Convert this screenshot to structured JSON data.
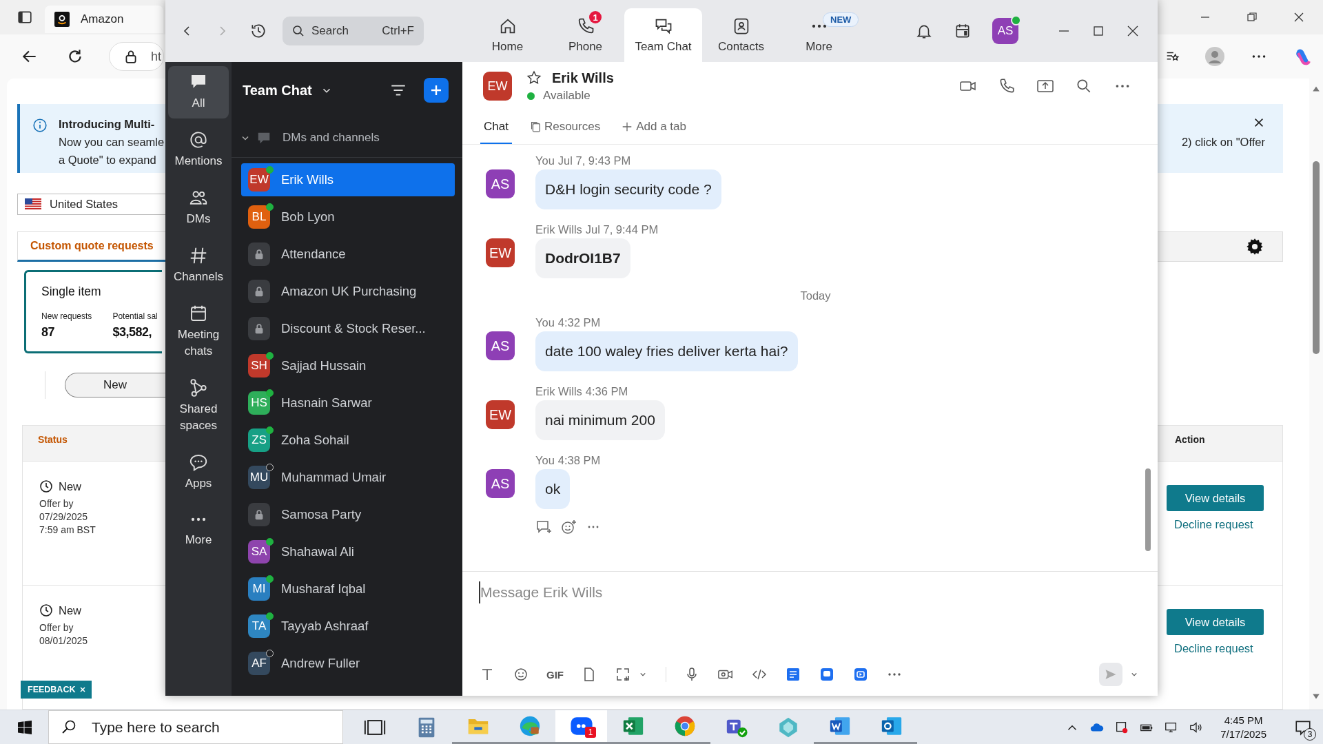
{
  "browser": {
    "tab_title": "Amazon",
    "address": "ht",
    "banner": {
      "title": "Introducing Multi-",
      "line_1": "Now you can seamle",
      "line_2": "a Quote\" to expand",
      "right_text": "2) click on \"Offer"
    },
    "country": "United States",
    "section_tab": "Custom quote requests",
    "card": {
      "title": "Single item",
      "stats": [
        {
          "label": "New requests",
          "value": "87"
        },
        {
          "label": "Potential sal",
          "value": "$3,582,"
        }
      ]
    },
    "filter_button": "New",
    "table": {
      "status_column": "Status",
      "action_column": "Action",
      "rows": [
        {
          "status": "New",
          "offer_label": "Offer by",
          "date": "07/29/2025",
          "time": "7:59 am BST",
          "primary_action": "View details",
          "secondary_action": "Decline request"
        },
        {
          "status": "New",
          "offer_label": "Offer by",
          "date": "08/01/2025",
          "primary_action": "View details",
          "secondary_action": "Decline request"
        }
      ]
    },
    "feedback": "FEEDBACK"
  },
  "zoom": {
    "search": {
      "placeholder": "Search",
      "shortcut": "Ctrl+F"
    },
    "tabs": [
      {
        "label": "Home",
        "kind": "home",
        "selected": false
      },
      {
        "label": "Phone",
        "kind": "phone",
        "selected": false,
        "badge": "1"
      },
      {
        "label": "Team Chat",
        "kind": "chat",
        "selected": true
      },
      {
        "label": "Contacts",
        "kind": "contacts",
        "selected": false
      },
      {
        "label": "More",
        "kind": "more",
        "selected": false,
        "badge": "NEW"
      }
    ],
    "user": {
      "initials": "AS",
      "color": "#8e3fb5"
    },
    "rail": [
      {
        "label": "All",
        "kind": "all",
        "selected": true
      },
      {
        "label": "Mentions",
        "kind": "mentions",
        "selected": false
      },
      {
        "label": "DMs",
        "kind": "dms",
        "selected": false
      },
      {
        "label": "Channels",
        "kind": "channels",
        "selected": false
      },
      {
        "label": "Meeting chats",
        "kind": "meetings",
        "selected": false
      },
      {
        "label": "Shared spaces",
        "kind": "shared",
        "selected": false
      },
      {
        "label": "Apps",
        "kind": "apps",
        "selected": false
      },
      {
        "label": "More",
        "kind": "more",
        "selected": false
      }
    ],
    "list_title": "Team Chat",
    "section": "DMs and channels",
    "conversations": [
      {
        "name": "Erik Wills",
        "kind": "person",
        "initials": "EW",
        "color": "#c0392b",
        "online": true,
        "selected": true
      },
      {
        "name": "Bob Lyon",
        "kind": "person",
        "initials": "BL",
        "color": "#e0600f",
        "online": true,
        "selected": false
      },
      {
        "name": "Attendance",
        "kind": "channel",
        "selected": false
      },
      {
        "name": "Amazon UK Purchasing",
        "kind": "channel",
        "selected": false
      },
      {
        "name": "Discount & Stock Reser...",
        "kind": "channel",
        "selected": false
      },
      {
        "name": "Sajjad Hussain",
        "kind": "person",
        "initials": "SH",
        "color": "#c0392b",
        "online": true,
        "selected": false
      },
      {
        "name": "Hasnain Sarwar",
        "kind": "person",
        "initials": "HS",
        "color": "#2eae5a",
        "online": true,
        "selected": false
      },
      {
        "name": "Zoha Sohail",
        "kind": "person",
        "initials": "ZS",
        "color": "#17a085",
        "online": true,
        "selected": false
      },
      {
        "name": "Muhammad Umair",
        "kind": "person",
        "initials": "MU",
        "color": "#34495e",
        "online": false,
        "selected": false
      },
      {
        "name": "Samosa Party",
        "kind": "channel",
        "selected": false
      },
      {
        "name": "Shahawal Ali",
        "kind": "person",
        "initials": "SA",
        "color": "#8e44ad",
        "online": true,
        "selected": false
      },
      {
        "name": "Musharaf Iqbal",
        "kind": "person",
        "initials": "MI",
        "color": "#2a7fc0",
        "online": true,
        "selected": false
      },
      {
        "name": "Tayyab Ashraaf",
        "kind": "person",
        "initials": "TA",
        "color": "#2e86c1",
        "online": true,
        "selected": false
      },
      {
        "name": "Andrew Fuller",
        "kind": "person",
        "initials": "AF",
        "color": "#34495e",
        "online": false,
        "selected": false
      }
    ],
    "chat": {
      "name": "Erik Wills",
      "initials": "EW",
      "color": "#c0392b",
      "presence": "Available",
      "tabs": [
        {
          "label": "Chat",
          "kind": "chat",
          "selected": true
        },
        {
          "label": "Resources",
          "kind": "resources",
          "selected": false
        },
        {
          "label": "Add a tab",
          "kind": "add",
          "selected": false
        }
      ],
      "messages": [
        {
          "kind": "self",
          "sender": "You",
          "initials": "AS",
          "color": "#8e3fb5",
          "time": "Jul 7, 9:43 PM",
          "text": "D&H login security code ?",
          "bold": false
        },
        {
          "kind": "other",
          "sender": "Erik Wills",
          "initials": "EW",
          "color": "#c0392b",
          "time": "Jul 7, 9:44 PM",
          "text": "DodrOI1B7",
          "bold": true
        },
        {
          "kind": "date",
          "text": "Today"
        },
        {
          "kind": "self",
          "sender": "You",
          "initials": "AS",
          "color": "#8e3fb5",
          "time": "4:32 PM",
          "text": "date 100 waley fries deliver kerta hai?",
          "bold": false
        },
        {
          "kind": "other",
          "sender": "Erik Wills",
          "initials": "EW",
          "color": "#c0392b",
          "time": "4:36 PM",
          "text": "nai minimum 200",
          "bold": false
        },
        {
          "kind": "self",
          "sender": "You",
          "initials": "AS",
          "color": "#8e3fb5",
          "time": "4:38 PM",
          "text": "ok",
          "bold": false
        }
      ],
      "composer": {
        "placeholder": "Message Erik Wills",
        "gif_label": "GIF"
      }
    }
  },
  "taskbar": {
    "search": {
      "placeholder": "Type here to search"
    },
    "apps": [
      {
        "kind": "task-view",
        "running": false
      },
      {
        "kind": "calculator",
        "running": false
      },
      {
        "kind": "folder",
        "running": true
      },
      {
        "kind": "edge",
        "running": true
      },
      {
        "kind": "zoom",
        "running": true,
        "badge": "1"
      },
      {
        "kind": "excel",
        "running": true
      },
      {
        "kind": "chrome",
        "running": true
      },
      {
        "kind": "teams",
        "running": false
      },
      {
        "kind": "gem",
        "running": false
      },
      {
        "kind": "word",
        "running": true
      },
      {
        "kind": "outlook",
        "running": true
      }
    ],
    "time": "4:45 PM",
    "date": "7/17/2025",
    "notifications": "3"
  }
}
